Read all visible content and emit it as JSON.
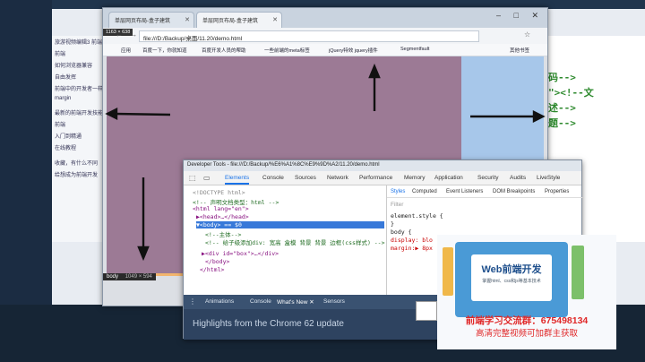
{
  "background": {
    "left_items": [
      "旅游视频编辑3 前端",
      "前端",
      "如何浏览器兼容",
      "自由发挥",
      "前端中的开发者一样的主",
      "margin",
      "",
      "最新的前端开发技能",
      "前端",
      "入门到精通",
      "在线教程",
      "",
      "收藏，有什么不同",
      "给想成为前端开发"
    ],
    "code_lines": [
      "码-->",
      "\"><!--文",
      "述-->",
      "题-->"
    ]
  },
  "browser": {
    "tabs": [
      {
        "label": "单层网页布局-盒子建筑",
        "active": false
      },
      {
        "label": "单层网页布局-盒子建筑",
        "active": true
      }
    ],
    "window_controls": "– □ ✕",
    "nav_icons": "← → ↻",
    "size_badge": "1163 × 638",
    "address": "file:///D:/Backup/桌面/11.20/demo.html",
    "bookmarks": [
      "应用",
      "百度一下，你就知道",
      "百度开发人员的帮助",
      "一些前端的meta标签",
      "jQuery特效 jquery插件",
      "Segmentfault",
      "其他书签"
    ],
    "body_tag_badge": "body",
    "body_tag_size": "1049 × 594"
  },
  "devtools": {
    "title": "Developer Tools - file:///D:/Backup/%E6%A1%8C%E9%9D%A2/11.20/demo.html",
    "tabs": [
      "Elements",
      "Console",
      "Sources",
      "Network",
      "Performance",
      "Memory",
      "Application",
      "Security",
      "Audits",
      "LiveStyle"
    ],
    "selected_tab": "Elements",
    "dom": {
      "doctype": "<!DOCTYPE html>",
      "comment1": "<!-- 声明文档类型：html -->",
      "html_open": "<html lang=\"en\">",
      "head": "▶<head>…</head>",
      "body_open": "▼<body> == $0",
      "comment2": "<!--主体-->",
      "comment3": "<!-- 给子级添加div: 宽高 盒模 背景 背景 边框(css样式) -->",
      "div": "▶<div id=\"box\">…</div>",
      "body_close": "</body>",
      "html_close": "</html>"
    },
    "style_tabs": [
      "Styles",
      "Computed",
      "Event Listeners",
      "DOM Breakpoints",
      "Properties"
    ],
    "filter_placeholder": "Filter",
    "style_rules": [
      "element.style {",
      "}",
      "body {",
      "  display: blo",
      "  margin:▶ 8px"
    ],
    "drawer_tabs": [
      "Animations",
      "Console",
      "What's New ✕",
      "Sensors"
    ],
    "drawer_message": "Highlights from the Chrome 62 update"
  },
  "promo": {
    "title": "Web前端开发",
    "subtitle": "掌握html、css和js等基本技术",
    "qq_line": "前端学习交流群：675498134",
    "tip_line": "高清完整视频可加群主获取"
  }
}
